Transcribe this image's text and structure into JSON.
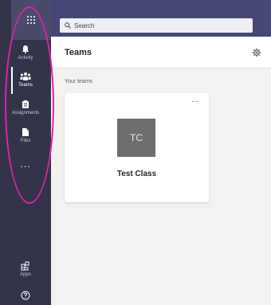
{
  "search": {
    "placeholder": "Search"
  },
  "rail": {
    "items": [
      {
        "label": "Activity",
        "icon": "bell-icon"
      },
      {
        "label": "Teams",
        "icon": "teams-icon",
        "active": true
      },
      {
        "label": "Assignments",
        "icon": "assignments-icon"
      },
      {
        "label": "Files",
        "icon": "file-icon"
      },
      {
        "label": "Apps",
        "icon": "apps-icon"
      }
    ],
    "more": "..."
  },
  "main": {
    "title": "Teams",
    "section_label": "Your teams",
    "teams": [
      {
        "initials": "TC",
        "name": "Test Class",
        "more": "..."
      }
    ]
  },
  "colors": {
    "rail": "#33344a",
    "topbar": "#464775",
    "accent": "#6264a7",
    "annotation": "#e020b0"
  }
}
